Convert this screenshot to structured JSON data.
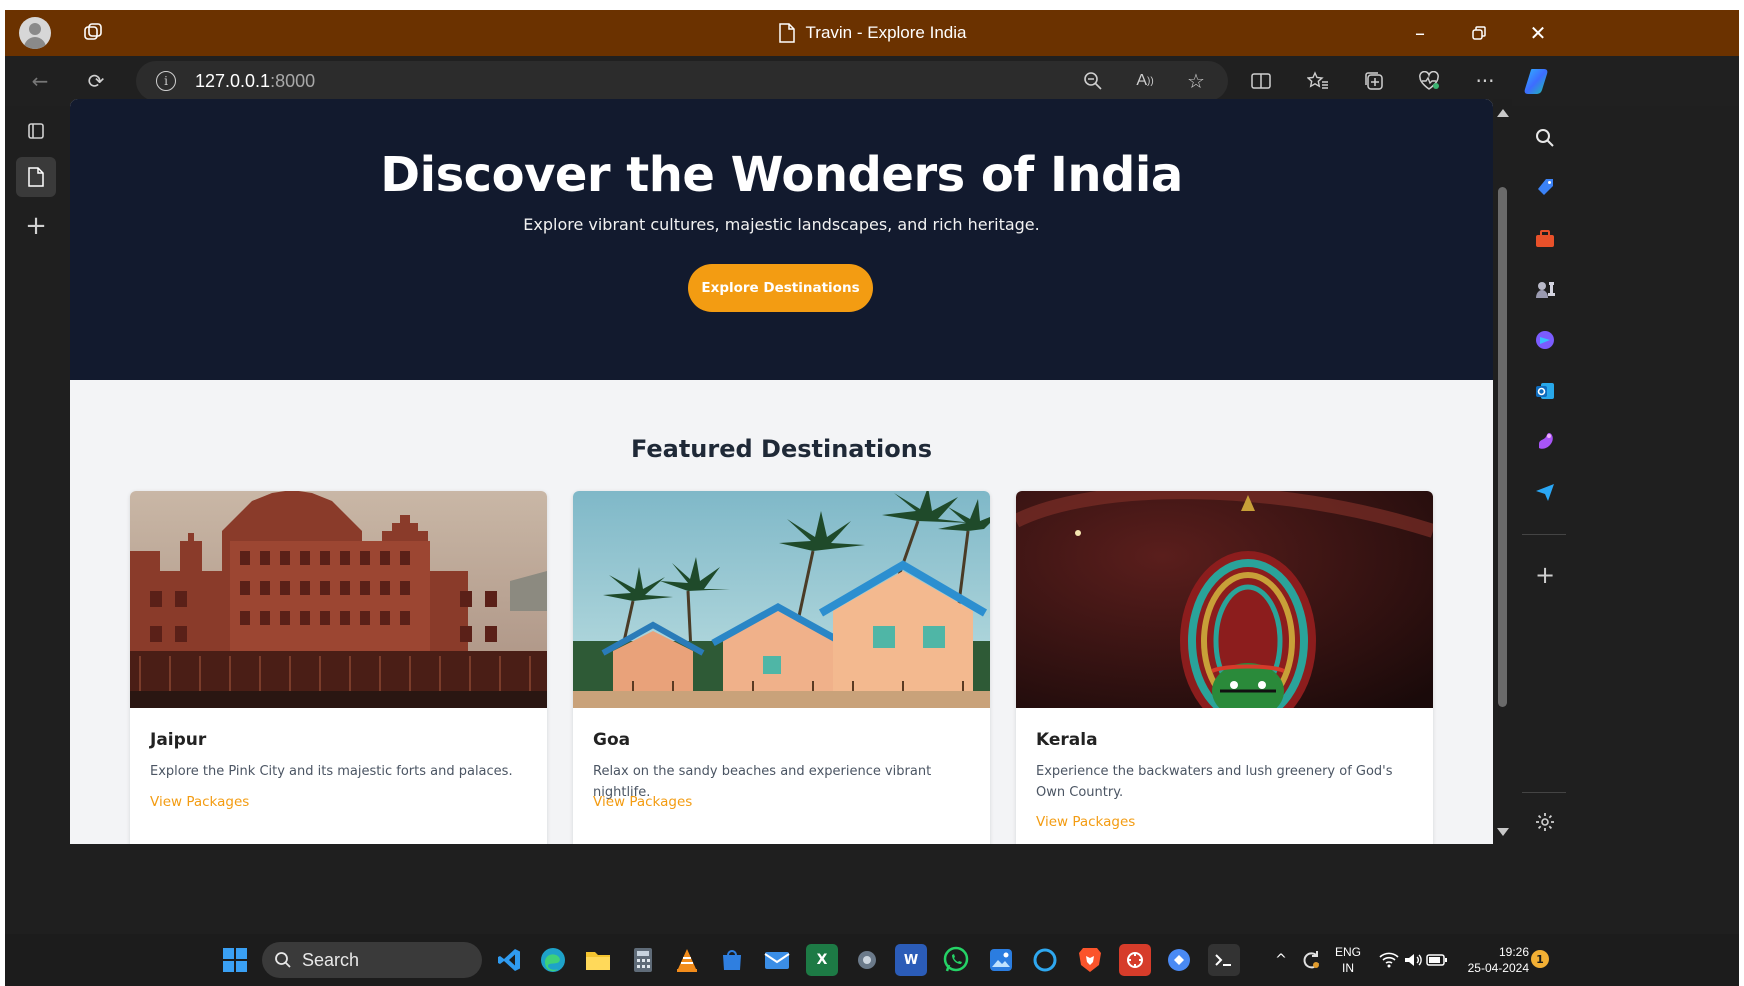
{
  "browser": {
    "tab_title": "Travin - Explore India",
    "url_host": "127.0.0.1",
    "url_port": ":8000",
    "titlebar_color": "#6b3200"
  },
  "hero": {
    "title": "Discover the Wonders of India",
    "subtitle": "Explore vibrant cultures, majestic landscapes, and rich heritage.",
    "cta": "Explore Destinations",
    "bg_color": "#121a2e",
    "accent_color": "#f39c12"
  },
  "featured": {
    "title": "Featured Destinations",
    "cards": [
      {
        "name": "Jaipur",
        "description": "Explore the Pink City and its majestic forts and palaces.",
        "link": "View Packages"
      },
      {
        "name": "Goa",
        "description": "Relax on the sandy beaches and experience vibrant nightlife.",
        "link": "View Packages"
      },
      {
        "name": "Kerala",
        "description": "Experience the backwaters and lush greenery of God's Own Country.",
        "link": "View Packages"
      }
    ]
  },
  "taskbar": {
    "search_label": "Search",
    "lang_line1": "ENG",
    "lang_line2": "IN",
    "time": "19:26",
    "date": "25-04-2024",
    "notification_count": "1"
  }
}
